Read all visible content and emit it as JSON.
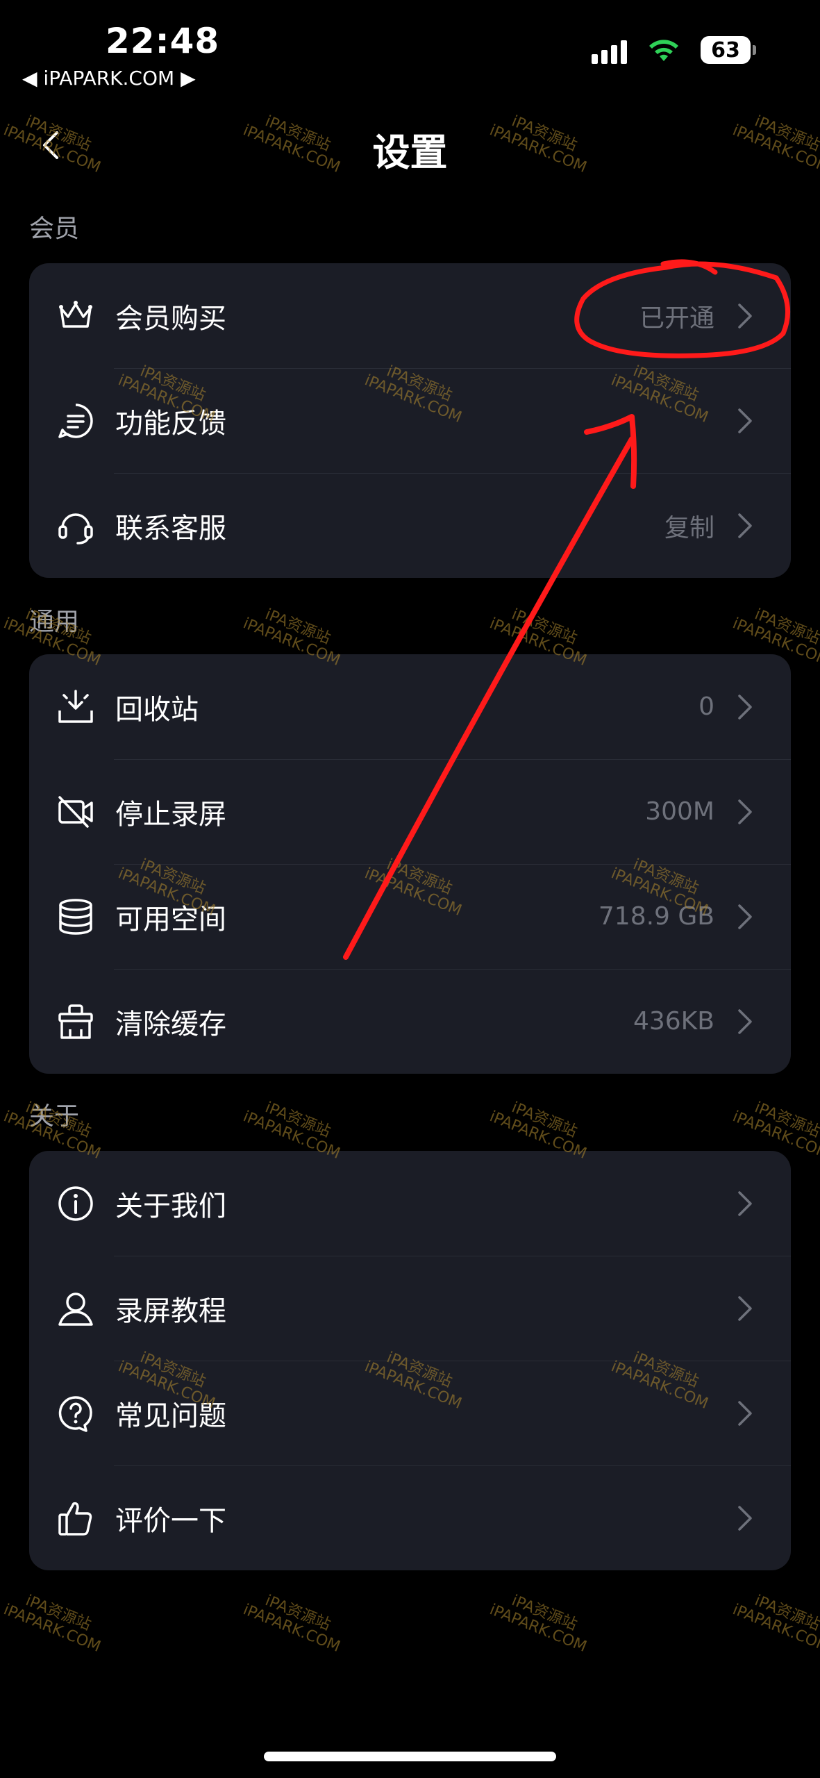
{
  "status_bar": {
    "time": "22:48",
    "back_app": "◀ iPAPARK.COM ▶",
    "battery": "63"
  },
  "nav": {
    "title": "设置"
  },
  "sections": [
    {
      "title": "会员",
      "rows": [
        {
          "icon": "crown-icon",
          "label": "会员购买",
          "value": "已开通"
        },
        {
          "icon": "feedback-icon",
          "label": "功能反馈",
          "value": ""
        },
        {
          "icon": "headset-icon",
          "label": "联系客服",
          "value": "复制"
        }
      ]
    },
    {
      "title": "通用",
      "rows": [
        {
          "icon": "recycle-bin-icon",
          "label": "回收站",
          "value": "0"
        },
        {
          "icon": "camera-off-icon",
          "label": "停止录屏",
          "value": "300M"
        },
        {
          "icon": "storage-icon",
          "label": "可用空间",
          "value": "718.9 GB"
        },
        {
          "icon": "broom-icon",
          "label": "清除缓存",
          "value": "436KB"
        }
      ]
    },
    {
      "title": "关于",
      "rows": [
        {
          "icon": "info-icon",
          "label": "关于我们",
          "value": ""
        },
        {
          "icon": "user-tutorial-icon",
          "label": "录屏教程",
          "value": ""
        },
        {
          "icon": "faq-icon",
          "label": "常见问题",
          "value": ""
        },
        {
          "icon": "thumbs-up-icon",
          "label": "评价一下",
          "value": ""
        }
      ]
    }
  ],
  "watermark": {
    "line1": "iPA资源站",
    "line2": "iPAPARK.COM"
  },
  "colors": {
    "background": "#000000",
    "card": "#1b1d26",
    "value_text": "#6e717b",
    "annotation": "#ff1a1a",
    "watermark": "#b08a30"
  }
}
